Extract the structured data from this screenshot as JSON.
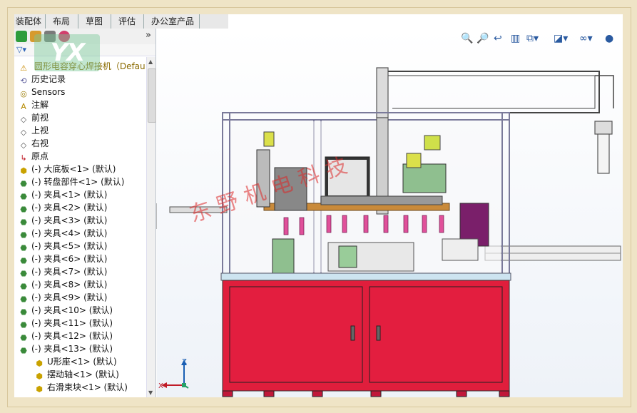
{
  "command_tabs": [
    "装配体",
    "布局",
    "草图",
    "评估",
    "办公室产品"
  ],
  "panel_overflow_icon": "double-chevron-right",
  "tree": {
    "root": "圆形电容穿心焊接机（Defau",
    "items": [
      {
        "label": "历史记录",
        "icon": "history-icon"
      },
      {
        "label": "Sensors",
        "icon": "sensor-icon"
      },
      {
        "label": "注解",
        "icon": "annotation-icon"
      },
      {
        "label": "前视",
        "icon": "plane-icon"
      },
      {
        "label": "上视",
        "icon": "plane-icon"
      },
      {
        "label": "右视",
        "icon": "plane-icon"
      },
      {
        "label": "原点",
        "icon": "origin-icon"
      },
      {
        "label": "(-) 大底板<1> (默认)",
        "icon": "part-icon"
      },
      {
        "label": "(-) 转盘部件<1> (默认)",
        "icon": "assembly-icon"
      },
      {
        "label": "(-) 夹具<1> (默认)",
        "icon": "assembly-icon"
      },
      {
        "label": "(-) 夹具<2> (默认)",
        "icon": "assembly-icon"
      },
      {
        "label": "(-) 夹具<3> (默认)",
        "icon": "assembly-icon"
      },
      {
        "label": "(-) 夹具<4> (默认)",
        "icon": "assembly-icon"
      },
      {
        "label": "(-) 夹具<5> (默认)",
        "icon": "assembly-icon"
      },
      {
        "label": "(-) 夹具<6> (默认)",
        "icon": "assembly-icon"
      },
      {
        "label": "(-) 夹具<7> (默认)",
        "icon": "assembly-icon"
      },
      {
        "label": "(-) 夹具<8> (默认)",
        "icon": "assembly-icon"
      },
      {
        "label": "(-) 夹具<9> (默认)",
        "icon": "assembly-icon"
      },
      {
        "label": "(-) 夹具<10> (默认)",
        "icon": "assembly-icon"
      },
      {
        "label": "(-) 夹具<11> (默认)",
        "icon": "assembly-icon"
      },
      {
        "label": "(-) 夹具<12> (默认)",
        "icon": "assembly-icon"
      },
      {
        "label": "(-) 夹具<13> (默认)",
        "icon": "assembly-icon"
      },
      {
        "label": "U形座<1> (默认)",
        "icon": "part-icon"
      },
      {
        "label": "摆动轴<1> (默认)",
        "icon": "part-icon"
      },
      {
        "label": "右滑束块<1> (默认)",
        "icon": "part-icon"
      }
    ]
  },
  "watermark": "东野机电科技",
  "logo_text": "YX",
  "view_toolbar_icons": [
    "zoom-to-fit-icon",
    "zoom-area-icon",
    "previous-view-icon",
    "section-view-icon",
    "view-orientation-icon",
    "display-style-icon",
    "hide-show-icon",
    "appearance-icon"
  ],
  "axis_labels": {
    "z": "Z",
    "x": "X"
  }
}
